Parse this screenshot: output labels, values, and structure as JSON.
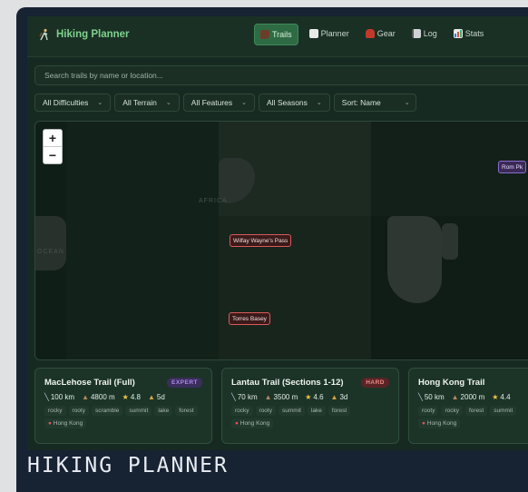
{
  "app": {
    "title": "Hiking Planner",
    "icon": "hiker-icon"
  },
  "nav": {
    "tabs": [
      {
        "label": "Trails",
        "icon": "boot-icon",
        "active": true
      },
      {
        "label": "Planner",
        "icon": "clipboard-icon",
        "active": false
      },
      {
        "label": "Gear",
        "icon": "backpack-icon",
        "active": false
      },
      {
        "label": "Log",
        "icon": "notebook-icon",
        "active": false
      },
      {
        "label": "Stats",
        "icon": "bar-chart-icon",
        "active": false
      }
    ]
  },
  "search": {
    "placeholder": "Search trails by name or location..."
  },
  "filters": [
    {
      "label": "All Difficulties"
    },
    {
      "label": "All Terrain"
    },
    {
      "label": "All Features"
    },
    {
      "label": "All Seasons"
    },
    {
      "label": "Sort: Name"
    }
  ],
  "map": {
    "zoom_in": "+",
    "zoom_out": "−",
    "markers": [
      {
        "label": "Wilfay Wayne's Pass",
        "color": "#d95a5a"
      },
      {
        "label": "Torres Basey",
        "color": "#d95a5a"
      },
      {
        "label": "Rom Pk",
        "color": "#8a6bd1"
      }
    ],
    "region_labels": [
      "AFRICA",
      "OCEAN"
    ]
  },
  "trails": [
    {
      "name": "MacLehose Trail (Full)",
      "difficulty": "EXPERT",
      "distance": "100 km",
      "elevation": "4800 m",
      "rating": "4.8",
      "duration": "5d",
      "tags": [
        "rocky",
        "rooty",
        "scramble",
        "summit",
        "lake",
        "forest"
      ],
      "location": "Hong Kong"
    },
    {
      "name": "Lantau Trail (Sections 1-12)",
      "difficulty": "HARD",
      "distance": "70 km",
      "elevation": "3500 m",
      "rating": "4.6",
      "duration": "3d",
      "tags": [
        "rocky",
        "rooty",
        "summit",
        "lake",
        "forest"
      ],
      "location": "Hong Kong"
    },
    {
      "name": "Hong Kong Trail",
      "difficulty": "",
      "distance": "50 km",
      "elevation": "2000 m",
      "rating": "4.4",
      "duration": "",
      "tags": [
        "rooty",
        "rocky",
        "forest",
        "summit"
      ],
      "location": "Hong Kong"
    }
  ],
  "caption": "HIKING PLANNER",
  "colors": {
    "accent": "#7fd28e",
    "active_tab": "#2e6b44",
    "background": "#172a22",
    "expert": "#a98be8",
    "hard": "#ee8d8d"
  }
}
